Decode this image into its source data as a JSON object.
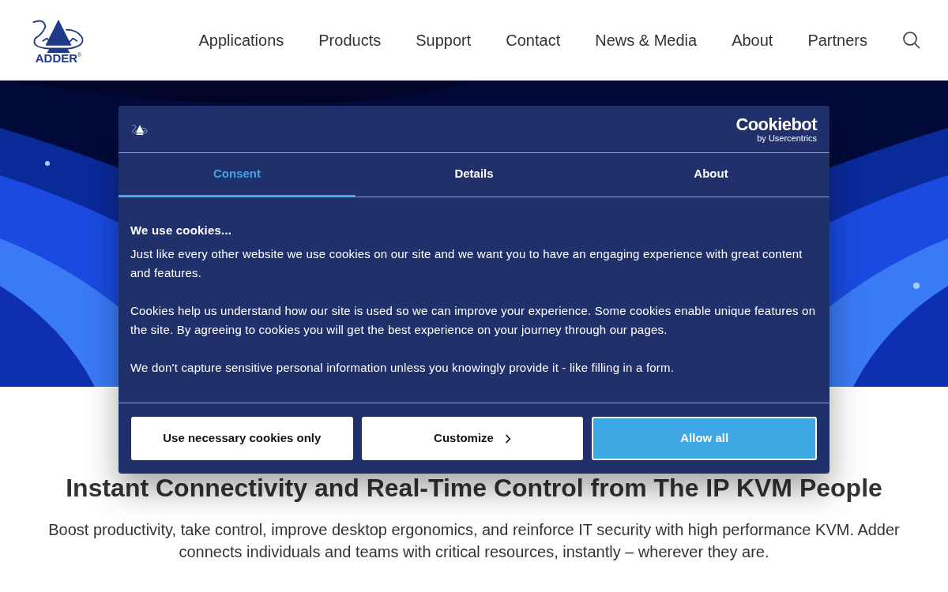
{
  "header": {
    "logo": {
      "text": "ADDER",
      "mark": "®"
    },
    "nav": [
      "Applications",
      "Products",
      "Support",
      "Contact",
      "News & Media",
      "About",
      "Partners"
    ]
  },
  "intro": {
    "heading": "Instant Connectivity and Real-Time Control from The IP KVM People",
    "text": "Boost productivity, take control, improve desktop ergonomics, and reinforce IT security with high performance KVM. Adder connects individuals and teams with critical resources, instantly – wherever they are."
  },
  "cookie_dialog": {
    "brand": {
      "name": "Cookiebot",
      "byline": "by Usercentrics"
    },
    "tabs": [
      {
        "label": "Consent",
        "selected": true
      },
      {
        "label": "Details",
        "selected": false
      },
      {
        "label": "About",
        "selected": false
      }
    ],
    "title": "We use cookies...",
    "paragraphs": [
      "Just like every other website we use cookies on our site and we want you to have an engaging experience with great content and features.",
      "Cookies help us understand how our site is used so we can improve your experience. Some cookies enable unique features on the site. By agreeing to cookies you will get the best experience on your journey through our pages.",
      "We don't capture sensitive personal information unless you knowingly provide it - like filling in a form."
    ],
    "buttons": [
      {
        "label": "Use necessary cookies only",
        "kind": "plain"
      },
      {
        "label": "Customize",
        "kind": "chevron"
      },
      {
        "label": "Allow all",
        "kind": "primary"
      }
    ]
  }
}
